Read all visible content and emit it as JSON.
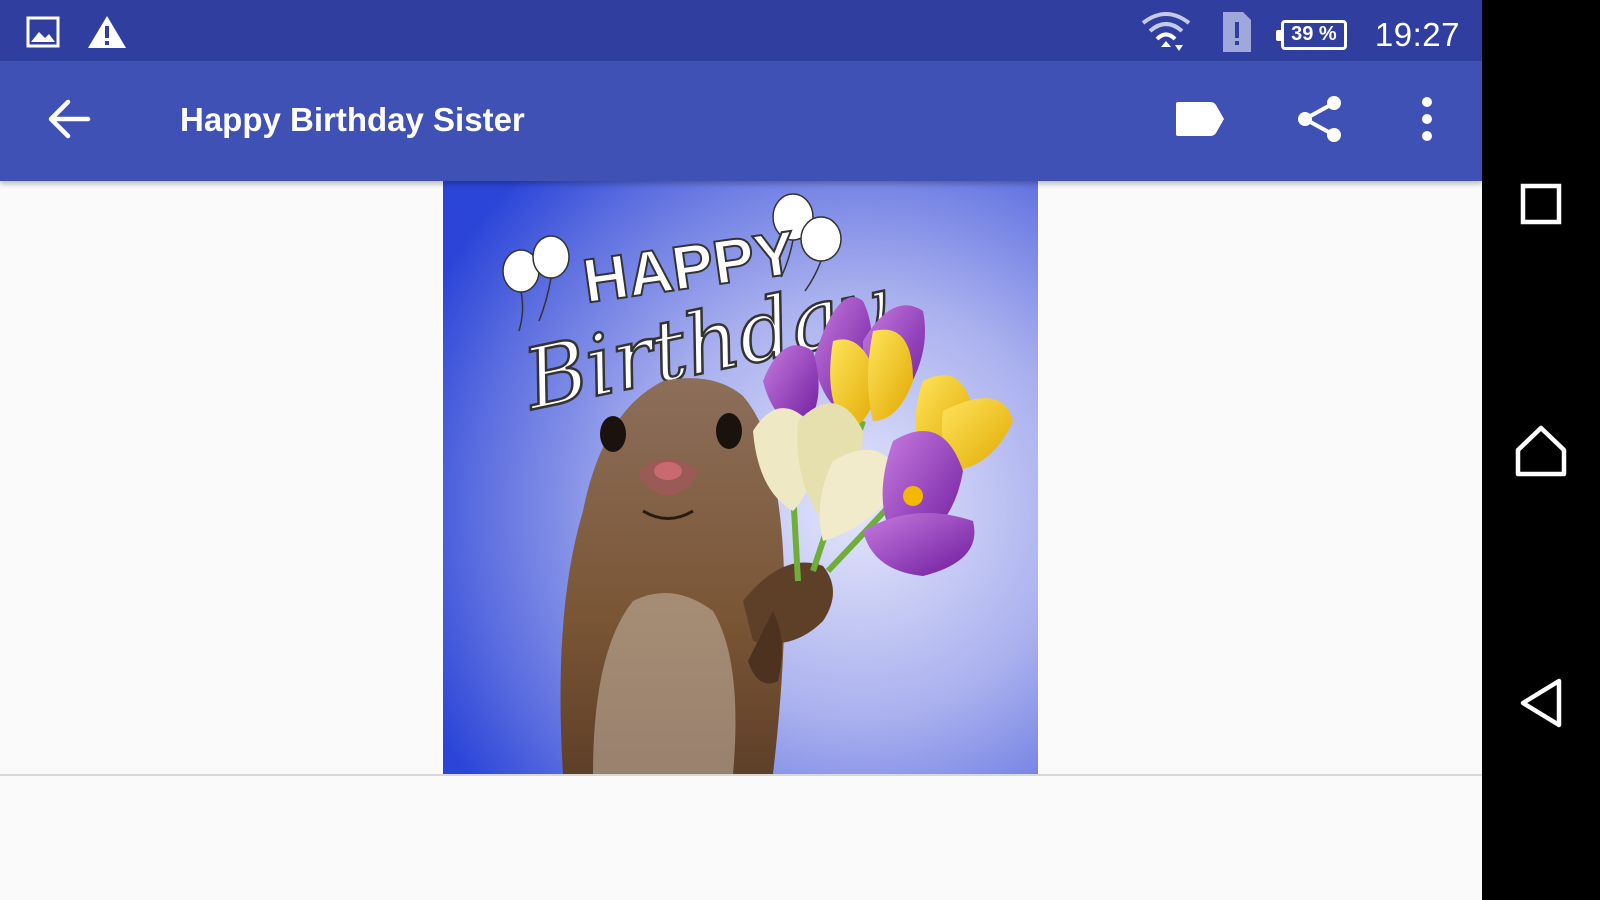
{
  "status_bar": {
    "time": "19:27",
    "battery": "39 %",
    "left_icons": [
      "image-icon",
      "warning-icon"
    ],
    "right_icons": [
      "wifi-icon",
      "sim-alert-icon",
      "battery-icon"
    ]
  },
  "app_bar": {
    "title": "Happy Birthday Sister",
    "back_icon": "arrow-back-icon",
    "actions": [
      "label-icon",
      "share-icon",
      "more-vert-icon"
    ],
    "background": "#3f51b5",
    "status_background": "#303f9f"
  },
  "card": {
    "text_line1": "HAPPY",
    "text_line2": "Birthday"
  },
  "nav_bar": {
    "buttons": [
      "recents-icon",
      "home-icon",
      "back-triangle-icon"
    ]
  }
}
